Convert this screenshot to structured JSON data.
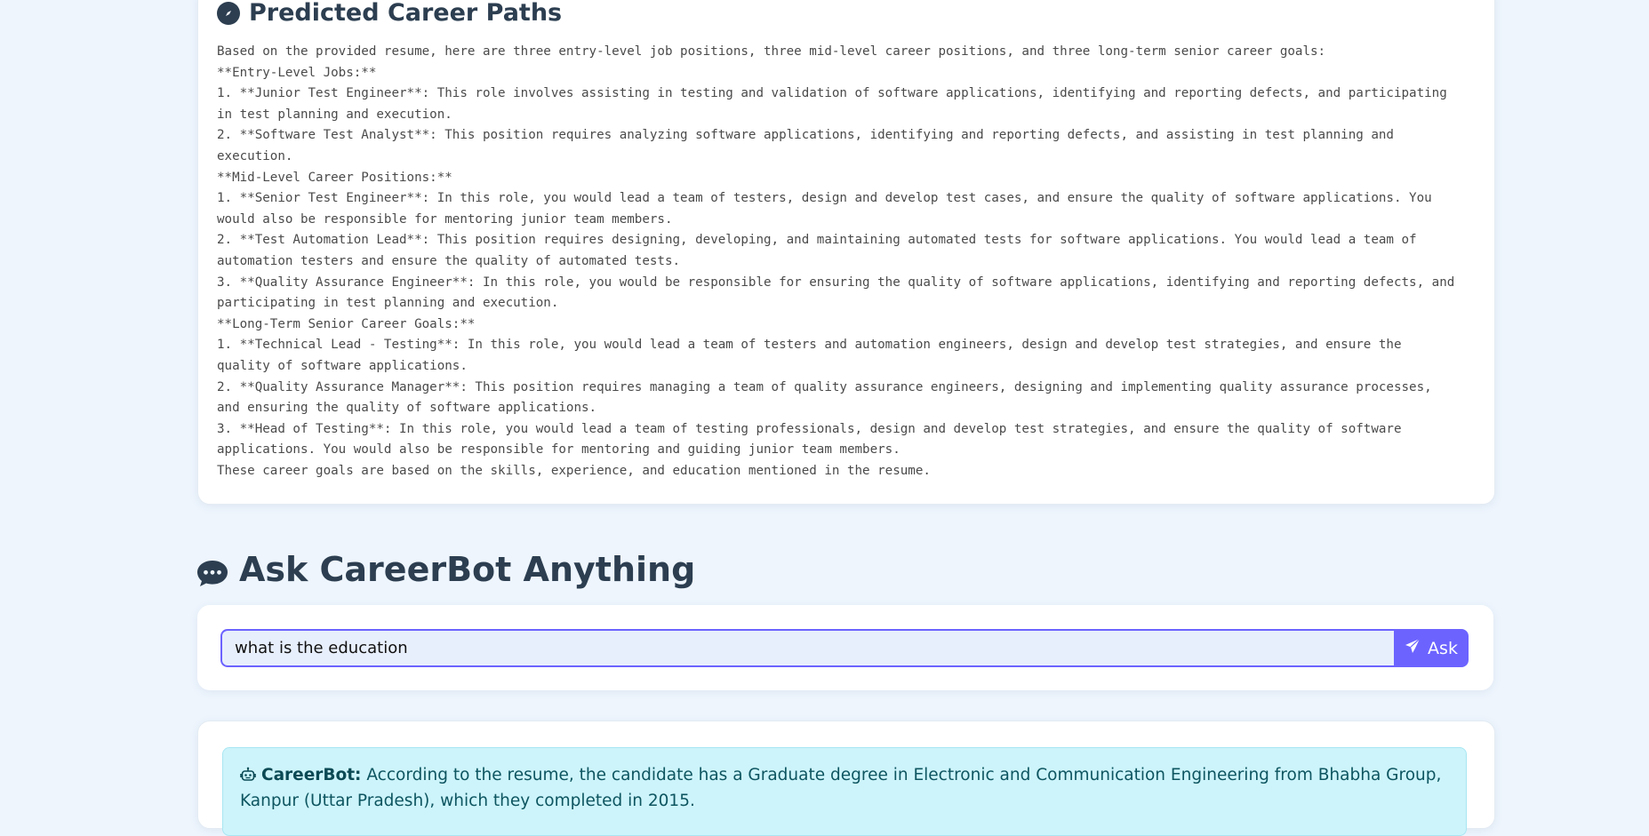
{
  "career_section": {
    "title": "Predicted Career Paths",
    "title_icon": "compass-icon",
    "lines": [
      "Based on the provided resume, here are three entry-level job positions, three mid-level career positions, and three long-term senior career goals:",
      "**Entry-Level Jobs:**",
      "1. **Junior Test Engineer**: This role involves assisting in testing and validation of software applications, identifying and reporting defects, and participating",
      "in test planning and execution.",
      "2. **Software Test Analyst**: This position requires analyzing software applications, identifying and reporting defects, and assisting in test planning and",
      "execution.",
      "**Mid-Level Career Positions:**",
      "1. **Senior Test Engineer**: In this role, you would lead a team of testers, design and develop test cases, and ensure the quality of software applications. You",
      "would also be responsible for mentoring junior team members.",
      "2. **Test Automation Lead**: This position requires designing, developing, and maintaining automated tests for software applications. You would lead a team of",
      "automation testers and ensure the quality of automated tests.",
      "3. **Quality Assurance Engineer**: In this role, you would be responsible for ensuring the quality of software applications, identifying and reporting defects, and",
      "participating in test planning and execution.",
      "**Long-Term Senior Career Goals:**",
      "1. **Technical Lead - Testing**: In this role, you would lead a team of testers and automation engineers, design and develop test strategies, and ensure the",
      "quality of software applications.",
      "2. **Quality Assurance Manager**: This position requires managing a team of quality assurance engineers, designing and implementing quality assurance processes,",
      "and ensuring the quality of software applications.",
      "3. **Head of Testing**: In this role, you would lead a team of testing professionals, design and develop test strategies, and ensure the quality of software",
      "applications. You would also be responsible for mentoring and guiding junior team members.",
      "These career goals are based on the skills, experience, and education mentioned in the resume."
    ]
  },
  "ask_section": {
    "title": "Ask CareerBot Anything",
    "title_icon": "chat-bubble-icon",
    "input_value": "what is the education",
    "button_label": "Ask",
    "button_icon": "paper-plane-icon"
  },
  "answer": {
    "bot_icon": "robot-icon",
    "bot_name": "CareerBot:",
    "text": " According to the resume, the candidate has a Graduate degree in Electronic and Communication Engineering from Bhabha Group, Kanpur (Uttar Pradesh), which they completed in 2015."
  },
  "colors": {
    "page_background": "#eef5fd",
    "heading": "#2c3e50",
    "accent": "#6c63ff",
    "answer_background": "#cdf4fb",
    "answer_text": "#0d5560"
  }
}
